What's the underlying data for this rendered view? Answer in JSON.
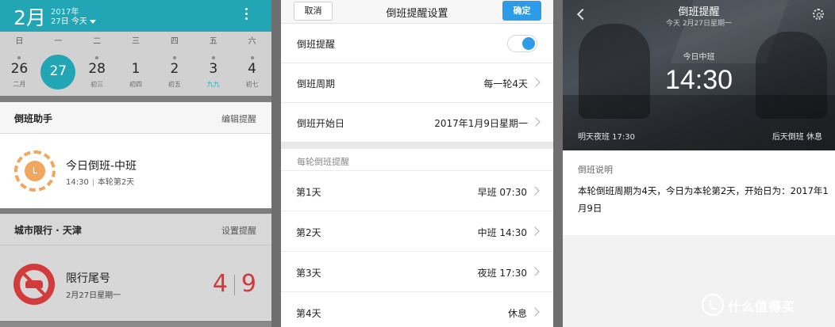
{
  "calendar": {
    "month": "2月",
    "year": "2017年",
    "today_label": "27日 今天",
    "weekdays": [
      "日",
      "一",
      "二",
      "三",
      "四",
      "五",
      "六"
    ],
    "dates": [
      {
        "day": "26",
        "lunar": "二月"
      },
      {
        "day": "27",
        "lunar": ""
      },
      {
        "day": "28",
        "lunar": "初三"
      },
      {
        "day": "1",
        "lunar": "初四"
      },
      {
        "day": "2",
        "lunar": "初五"
      },
      {
        "day": "3",
        "lunar": "九九"
      },
      {
        "day": "4",
        "lunar": "初七"
      }
    ],
    "shift_section": {
      "title": "倒班助手",
      "action": "编辑提醒",
      "card_icon_text": "L",
      "card_title": "今日倒班-中班",
      "card_time": "14:30",
      "card_round": "本轮第2天"
    },
    "traffic_section": {
      "title": "城市限行 · 天津",
      "action": "设置提醒",
      "card_title": "限行尾号",
      "card_date": "2月27日星期一",
      "num_a": "4",
      "num_b": "9"
    }
  },
  "settings": {
    "cancel_label": "取消",
    "title": "倒班提醒设置",
    "ok_label": "确定",
    "toggle_label": "倒班提醒",
    "toggle_on": true,
    "period_label": "倒班周期",
    "period_value": "每一轮4天",
    "start_label": "倒班开始日",
    "start_value": "2017年1月9日星期一",
    "group_title": "每轮倒班提醒",
    "days": [
      {
        "label": "第1天",
        "value": "早班 07:30"
      },
      {
        "label": "第2天",
        "value": "中班 14:30"
      },
      {
        "label": "第3天",
        "value": "夜班 17:30"
      },
      {
        "label": "第4天",
        "value": "休息"
      }
    ]
  },
  "reminder": {
    "title": "倒班提醒",
    "subtitle": "今天 2月27日星期一",
    "shift_label": "今日中班",
    "time": "14:30",
    "tomorrow": "明天夜班  17:30",
    "after_tomorrow": "后天倒班  休息",
    "desc_title": "倒班说明",
    "desc_body": "本轮倒班周期为4天，今日为本轮第2天，开始日为：2017年1月9日"
  },
  "watermark": {
    "text": "什么值得买"
  },
  "colors": {
    "teal": "#22a5b4",
    "blue": "#2d9ce8",
    "orange": "#f1a660",
    "red": "#cf3a3a"
  }
}
